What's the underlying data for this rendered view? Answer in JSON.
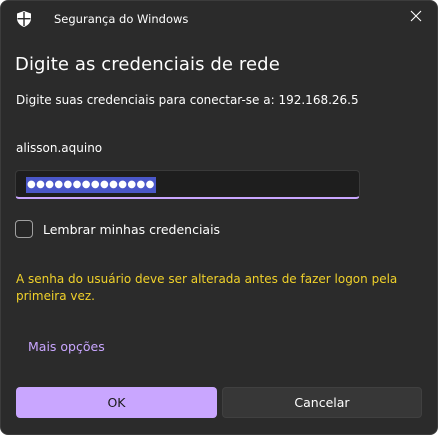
{
  "window": {
    "title": "Segurança do Windows",
    "close_icon": "close-icon",
    "app_icon": "shield-icon"
  },
  "dialog": {
    "heading": "Digite as credenciais de rede",
    "subtitle": "Digite suas credenciais para conectar-se a: 192.168.26.5",
    "username": "alisson.aquino",
    "password_masked": "●●●●●●●●●●●●●●",
    "remember_label": "Lembrar minhas credenciais",
    "remember_checked": false,
    "warning": "A senha do usuário deve ser alterada antes de fazer logon pela primeira vez.",
    "more_options": "Mais opções"
  },
  "buttons": {
    "ok": "OK",
    "cancel": "Cancelar"
  },
  "colors": {
    "background": "#2b2b2b",
    "accent": "#c9a6ff",
    "warning": "#f0d12a",
    "selection": "#4a57c9"
  }
}
